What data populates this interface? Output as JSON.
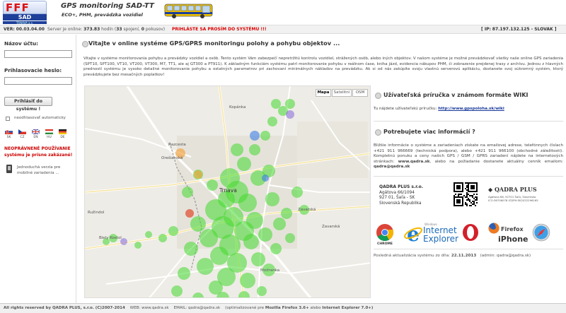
{
  "header": {
    "logo_main": "FFF",
    "logo_brand": "SAD",
    "logo_city": "TRNAVA a.s.",
    "title": "GPS monitoring SAD-TT",
    "subtitle": "ECO+, PHM, prevádzka vozidiel"
  },
  "status_bar": {
    "version_label": "VER:",
    "version": "00.03.04.00",
    "server_label": "Server je online:",
    "server_hours": "373.83",
    "server_unit": "hodín",
    "connections": "33",
    "connections_label": "spojení,",
    "attempts": "0",
    "attempts_label": "pokusov",
    "login_prompt": "PRIHLÁSTE SA PROSÍM DO SYSTÉMU !!!",
    "ip_label": "[ IP:",
    "ip": "87.197.132.125 - SLOVAK ]"
  },
  "login": {
    "username_label": "Názov účtu:",
    "username_value": "",
    "password_label": "Prihlasovacie heslo:",
    "password_value": "",
    "login_button": "Prihlásiť do systému !",
    "remember_label": "neodhlasovať automaticky",
    "languages": [
      "SK",
      "CZ",
      "EN",
      "HU",
      "DE"
    ],
    "warning_line1": "NEOPRÁVNENÉ POUŽÍVANIE",
    "warning_line2": "systému je prísne zakázané!",
    "mobile_line1": "Jednoduchá verzia pre",
    "mobile_line2": "mobilné zariadenia ..."
  },
  "main": {
    "title": "Vitajte v online systéme GPS/GPRS monitoringu polohy a pohybu objektov ...",
    "intro": "Vitajte v systéme monitorovania pohybu a prevádzky vozidiel a osôb. Tento systém Vám zabezpečí nepretržitú kontrolu vozidiel, strážených osôb, alebo iných objektov. V našom systéme je možné prevádzkovať všetky naše online GPS zariadenia (SPT10, SPT100, VT10, VT200, VT300, M7, TT1, ale aj GT300 a PT911). K základným funkciám systému patrí monitorovanie pohybu v reálnom čase, kniha jázd, evidencia nákupov PHM, či zobrazenie prejdenej trasy z archívu. Jednou z hlavných predností systému je vysoko detailné monitorovanie pohybu a ostatných parametrov pri zachovaní minimálnych nákladov na prevádzku. Ak si od nás zakúpite svoju vlastnú serverovú aplikáciu, dostanete svoj súkromný systém, ktorý prevádzkujete bez mesačných poplatkov!"
  },
  "map": {
    "types": [
      "Mapa",
      "Satelitní",
      "OSM"
    ],
    "active_type": "Mapa",
    "labels": [
      "Trnava",
      "Kopánka",
      "Modranka",
      "Zavarská",
      "Biely Kostol",
      "Ružindol",
      "Orešianská",
      "Razcesta",
      "Zavarská"
    ],
    "colors": {
      "dot": "#44d92e",
      "dot_orange": "#f5a23a",
      "dot_blue": "#3a7ee6",
      "dot_purple": "#7a5ad9",
      "dot_red": "#e04a2a"
    }
  },
  "manual": {
    "title": "Užívateľská príručka v známom formáte WIKI",
    "text": "Tu nájdete užívateľskú príručku:",
    "link": "http://www.gpspoloha.sk/wiki"
  },
  "info": {
    "title": "Potrebujete viac informácií ?",
    "text1": "Bližšie informácie o systéme a zariadeniach získate na emailovej adrese, telefónnych číslach +421 911 966669 (technická podpora), alebo +421 911 966100 (obchodné záležitosti). Kompletnú ponuku a ceny našich GPS / GSM / GPRS zariadení nájdete na internetových stránkach:",
    "web": "www.qadra.sk",
    "text2": ", alebo na požiadanie dostanete aktuálny cenník emailom:",
    "email": "qadra@qadra.sk"
  },
  "company": {
    "name": "QADRA PLUS s.r.o.",
    "street": "Agátova 66/1094",
    "city": "927 01, Šaľa - SK",
    "country": "Slovenská Republika",
    "brand": "QADRA PLUS",
    "brand_line1": "Agátova 66, 92701 Šaľa, Slovensko",
    "brand_line2": "IČO:36706078  IČDPH:SK2022296165"
  },
  "browsers": {
    "chrome": "CHROME",
    "ie_small": "Windows",
    "ie_line1": "Internet",
    "ie_line2": "Explorer",
    "firefox": "Firefox",
    "iphone": "iPhone"
  },
  "update": {
    "label": "Posledná aktualizácia systému zo dňa:",
    "date": "22.11.2013",
    "admin": "(admin: qadra@qadra.sk)"
  },
  "footer": {
    "copyright": "All rights reserved by QADRA PLUS, s.r.o. (C)2007-2014",
    "web_label": "WEB:",
    "web": "www.qadra.sk",
    "email_label": "EMAIL:",
    "email": "qadra@qadra.sk",
    "optim": "(optimalizované pre",
    "browser1": "Mozilla Firefox 3.6+",
    "or": "alebo",
    "browser2": "Internet Explorer 7.0+)"
  }
}
